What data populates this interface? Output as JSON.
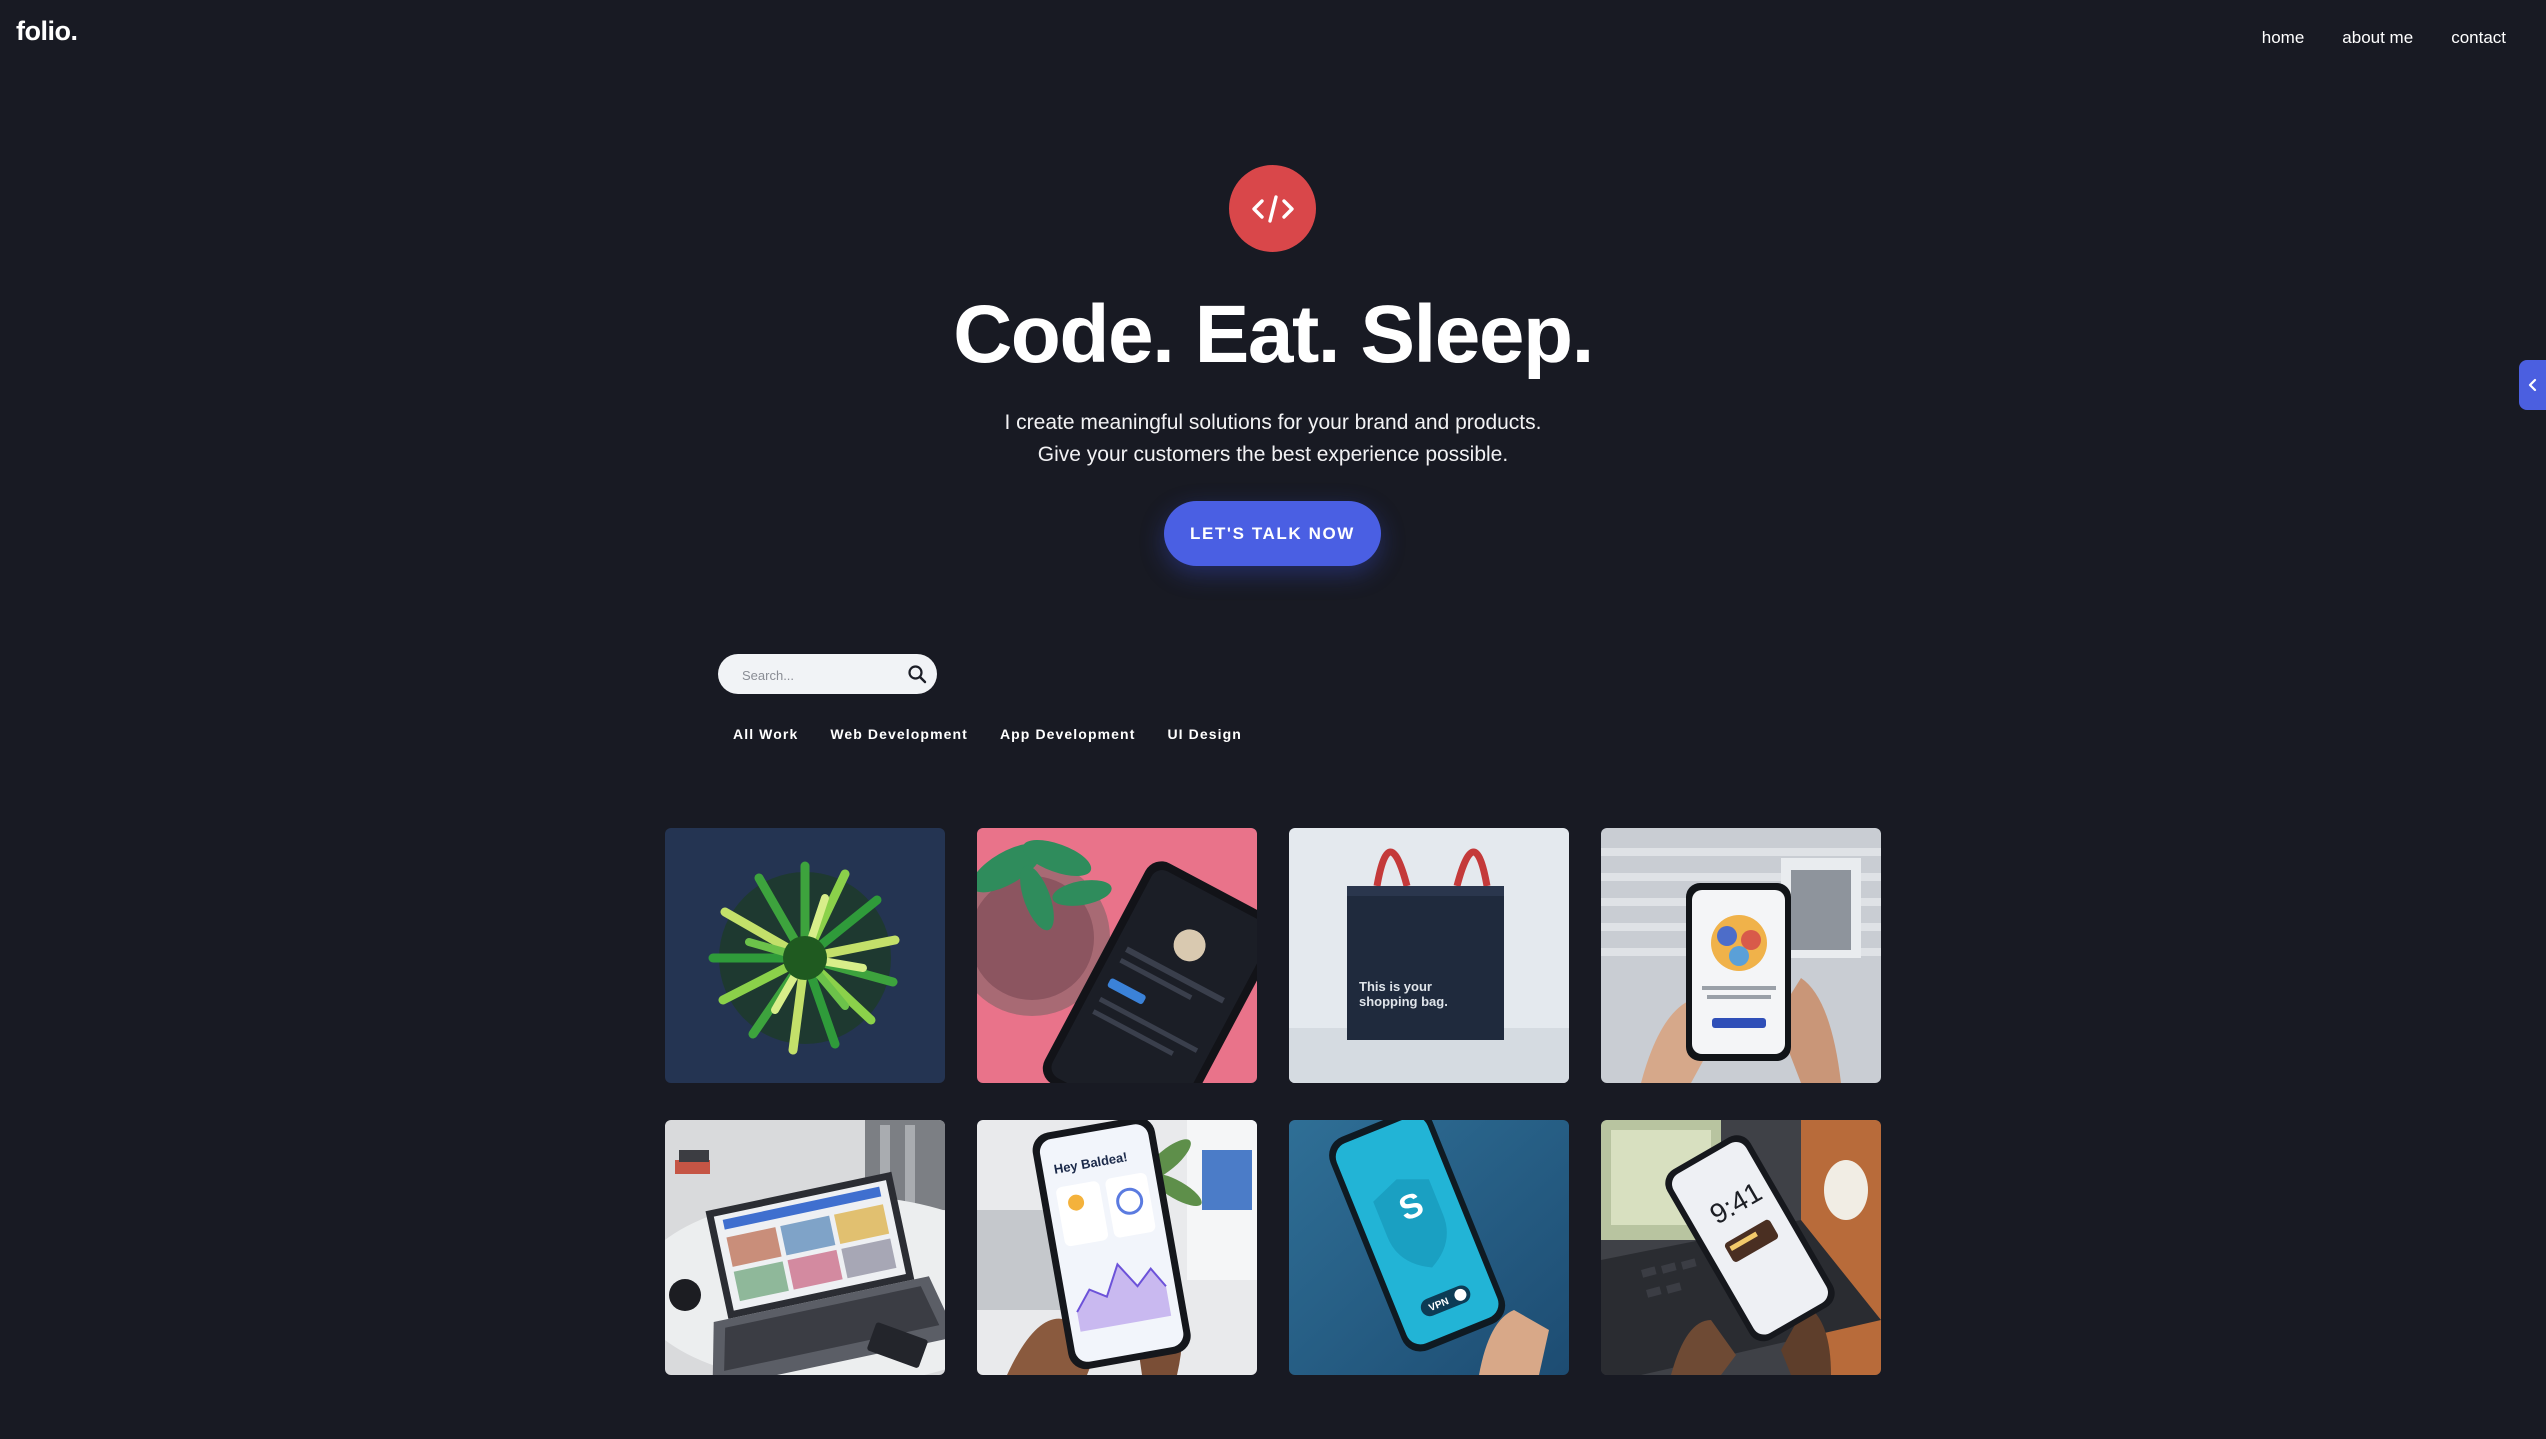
{
  "header": {
    "logo": "folio.",
    "nav": [
      "home",
      "about me",
      "contact"
    ]
  },
  "hero": {
    "badge_icon": "code-icon",
    "title": "Code. Eat. Sleep.",
    "subtitle_line1": "I create meaningful solutions for your brand and products.",
    "subtitle_line2": "Give your customers the best experience possible.",
    "cta_label": "LET'S TALK NOW"
  },
  "search": {
    "placeholder": "Search..."
  },
  "filters": [
    "All Work",
    "Web Development",
    "App Development",
    "UI Design"
  ],
  "portfolio": {
    "items": [
      {
        "kind": "green-sculpture"
      },
      {
        "kind": "phone-plant-pink"
      },
      {
        "kind": "shopping-bag",
        "caption_line1": "This is your",
        "caption_line2": "shopping bag."
      },
      {
        "kind": "phone-in-hands"
      },
      {
        "kind": "laptop-on-table"
      },
      {
        "kind": "weather-app-phone",
        "app_text": "Hey Baldea!"
      },
      {
        "kind": "vpn-phone",
        "app_text": "VPN"
      },
      {
        "kind": "lockscreen-phone",
        "app_text": "9:41"
      }
    ]
  },
  "colors": {
    "background": "#181a23",
    "accent_blue": "#4a5fe3",
    "accent_red": "#d9474a"
  }
}
